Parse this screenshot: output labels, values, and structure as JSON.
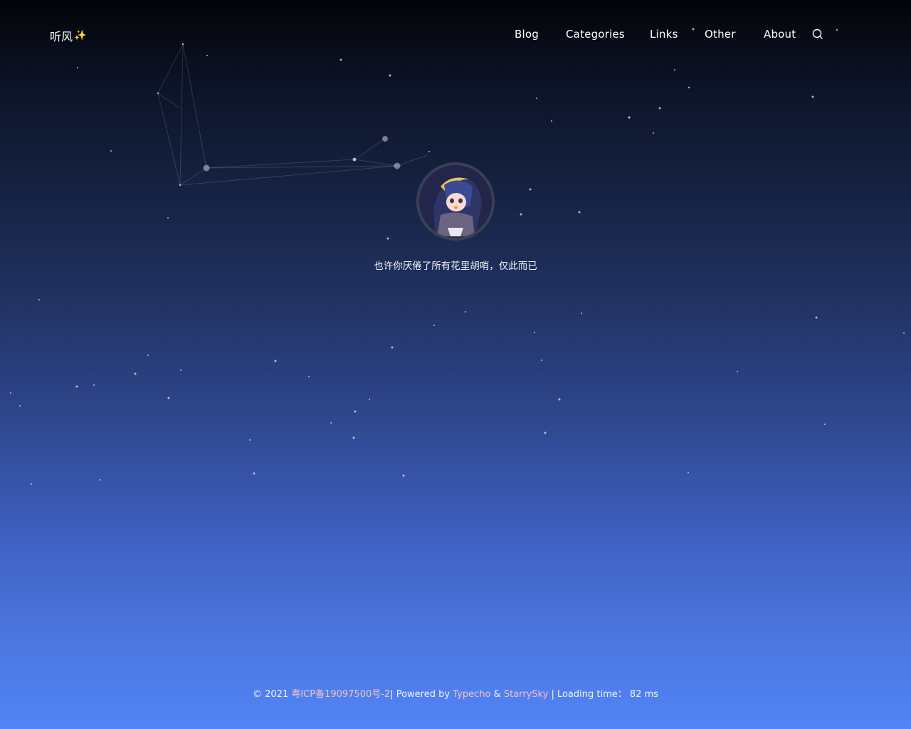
{
  "header": {
    "brand": "听风",
    "brand_icon": "sparkles-icon",
    "nav": [
      {
        "label": "Blog"
      },
      {
        "label": "Categories"
      },
      {
        "label": "Links"
      },
      {
        "label": "Other"
      },
      {
        "label": "About"
      }
    ],
    "search_icon": "search-icon"
  },
  "hero": {
    "avatar_alt": "anime-girl-avatar",
    "motto": "也许你厌倦了所有花里胡哨，仅此而已"
  },
  "footer": {
    "copyright": "© 2021",
    "icp": "粤ICP备19097500号-2",
    "sep1": "| Powered by",
    "typecho": "Typecho",
    "amp": "&",
    "theme": "StarrySky",
    "loading_prefix": "| Loading time：",
    "loading_value": "82 ms"
  },
  "colors": {
    "bg_top": "#030408",
    "bg_bottom": "#5285f7",
    "link_color": "#f4c2c2",
    "sparkle": "#ffe21a"
  }
}
